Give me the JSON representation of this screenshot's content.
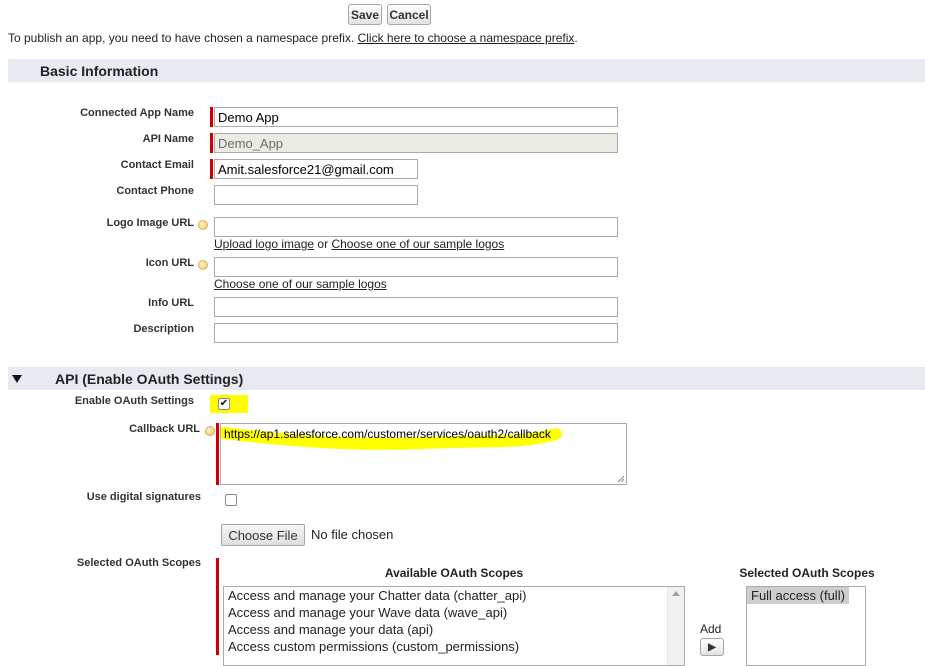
{
  "toolbar": {
    "save_label": "Save",
    "cancel_label": "Cancel"
  },
  "notice": {
    "text": "To publish an app, you need to have chosen a namespace prefix.",
    "link": "Click here to choose a namespace prefix",
    "suffix": "."
  },
  "basic_info": {
    "title": "Basic Information",
    "connected_app_name": {
      "label": "Connected App Name",
      "value": "Demo App"
    },
    "api_name": {
      "label": "API Name",
      "value": "Demo_App"
    },
    "contact_email": {
      "label": "Contact Email",
      "value": "Amit.salesforce21@gmail.com"
    },
    "contact_phone": {
      "label": "Contact Phone",
      "value": ""
    },
    "logo_image_url": {
      "label": "Logo Image URL",
      "value": "",
      "upload_link": "Upload logo image",
      "or_text": "or",
      "sample_link": "Choose one of our sample logos"
    },
    "icon_url": {
      "label": "Icon URL",
      "value": "",
      "sample_link": "Choose one of our sample logos"
    },
    "info_url": {
      "label": "Info URL",
      "value": ""
    },
    "description": {
      "label": "Description",
      "value": ""
    }
  },
  "api_section": {
    "title": "API (Enable OAuth Settings)",
    "enable_oauth": {
      "label": "Enable OAuth Settings",
      "checked": true,
      "check_glyph": "✔"
    },
    "callback_url": {
      "label": "Callback URL",
      "value": "https://ap1.salesforce.com/customer/services/oauth2/callback"
    },
    "digital_signatures": {
      "label": "Use digital signatures",
      "checked": false,
      "choose_file_label": "Choose File",
      "file_status": "No file chosen"
    },
    "oauth_scopes": {
      "label": "Selected OAuth Scopes",
      "available_title": "Available OAuth Scopes",
      "selected_title": "Selected OAuth Scopes",
      "available": [
        "Access and manage your Chatter data (chatter_api)",
        "Access and manage your Wave data (wave_api)",
        "Access and manage your data (api)",
        "Access custom permissions (custom_permissions)"
      ],
      "selected": [
        "Full access (full)"
      ],
      "add_label": "Add",
      "add_glyph": "▶"
    }
  },
  "colors": {
    "section_bg": "#e8eaf1",
    "required": "#cc0000",
    "highlight": "#ffff00"
  }
}
